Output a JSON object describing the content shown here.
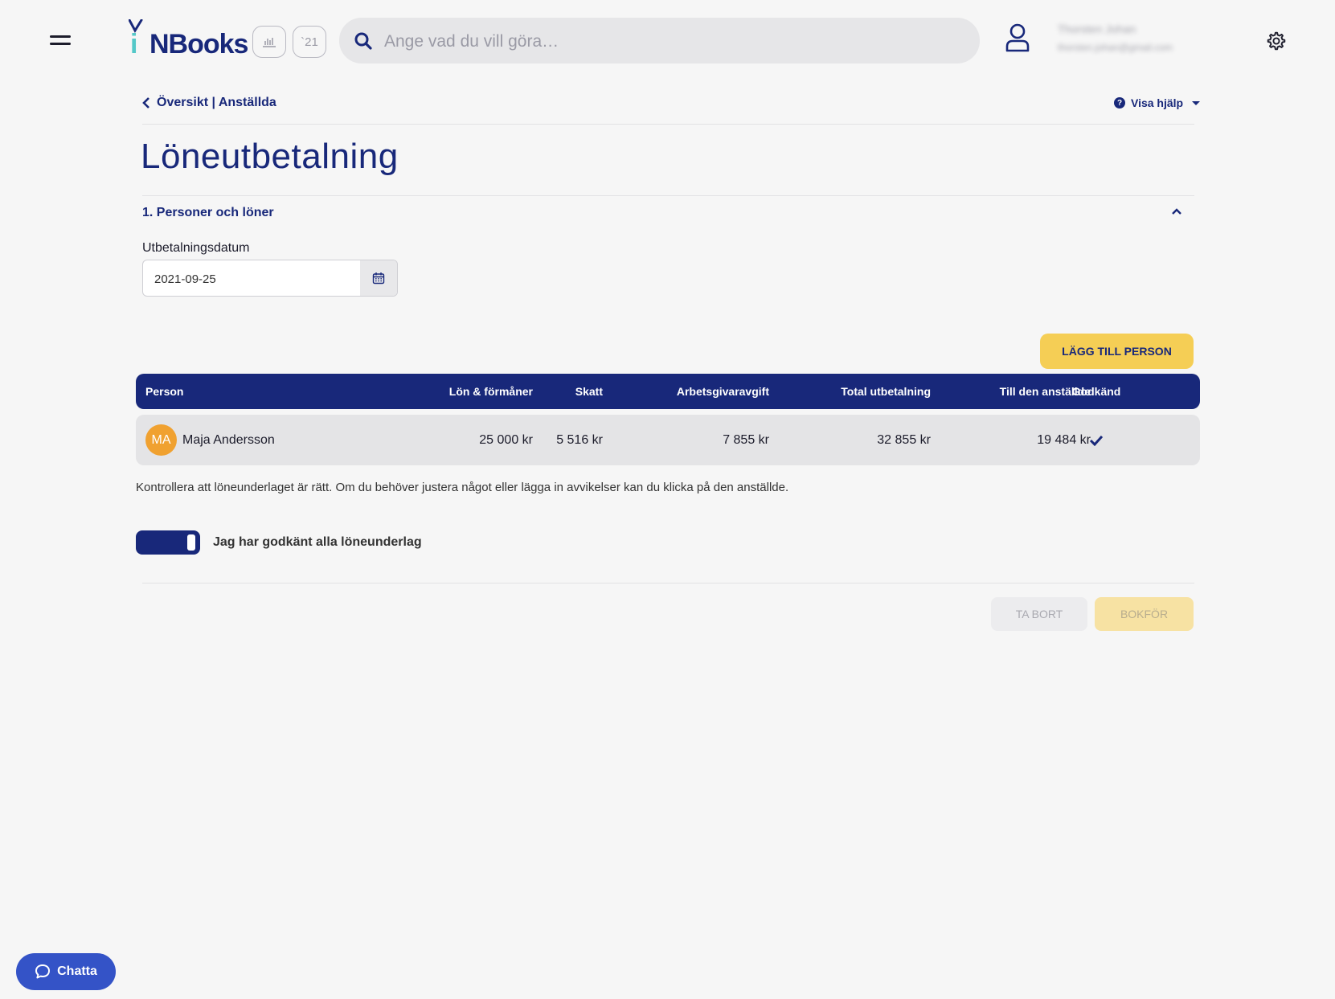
{
  "header": {
    "logo_text_i": "i",
    "logo_text_books": "NBooks",
    "year_label": "`21",
    "search_placeholder": "Ange vad du vill göra…",
    "user_name": "Thorsten Johan",
    "user_email": "thorsten.johan@gmail.com"
  },
  "breadcrumb": "Översikt | Anställda",
  "help_label": "Visa hjälp",
  "page_title": "Löneutbetalning",
  "section": {
    "title": "1. Personer och löner"
  },
  "payment_date": {
    "label": "Utbetalningsdatum",
    "value": "2021-09-25"
  },
  "add_person_label": "LÄGG TILL PERSON",
  "table": {
    "columns": [
      "Person",
      "Lön & förmåner",
      "Skatt",
      "Arbetsgivaravgift",
      "Total utbetalning",
      "Till den anställde",
      "Godkänd"
    ],
    "rows": [
      {
        "initials": "MA",
        "name": "Maja Andersson",
        "salary": "25 000 kr",
        "tax": "5 516 kr",
        "employer_fee": "7 855 kr",
        "total": "32 855 kr",
        "to_employee": "19 484 kr",
        "approved": true
      }
    ]
  },
  "note": "Kontrollera att löneunderlaget är rätt. Om du behöver justera något eller lägga in avvikelser kan du klicka på den anställde.",
  "approve_all": {
    "label": "Jag har godkänt alla löneunderlag",
    "checked": true
  },
  "actions": {
    "delete_label": "TA BORT",
    "book_label": "BOKFÖR"
  },
  "chat_label": "Chatta",
  "colors": {
    "primary": "#18287a",
    "accent": "#f5ce55",
    "avatar": "#f0a130",
    "chat": "#3453c7",
    "logo_teal": "#54c8c8"
  },
  "icons": [
    "menu-icon",
    "chart-icon",
    "search-icon",
    "user-icon",
    "gear-icon",
    "chevron-left-icon",
    "help-icon",
    "chevron-up-icon",
    "calendar-icon",
    "check-icon",
    "chat-icon"
  ]
}
